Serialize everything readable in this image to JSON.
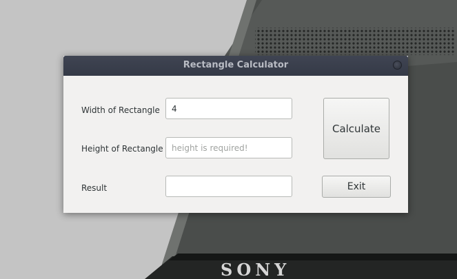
{
  "window": {
    "title": "Rectangle Calculator"
  },
  "form": {
    "width_label": "Width of Rectangle",
    "width_value": "4",
    "height_label": "Height of Rectangle",
    "height_value": "",
    "height_placeholder": "height is required!",
    "result_label": "Result",
    "result_value": ""
  },
  "buttons": {
    "calculate_label": "Calculate",
    "exit_label": "Exit"
  },
  "wallpaper": {
    "brand_text": "SONY"
  },
  "colors": {
    "titlebar": "#3a3f4c",
    "window_bg": "#f2f1f0",
    "title_text": "#b9bcc4"
  }
}
